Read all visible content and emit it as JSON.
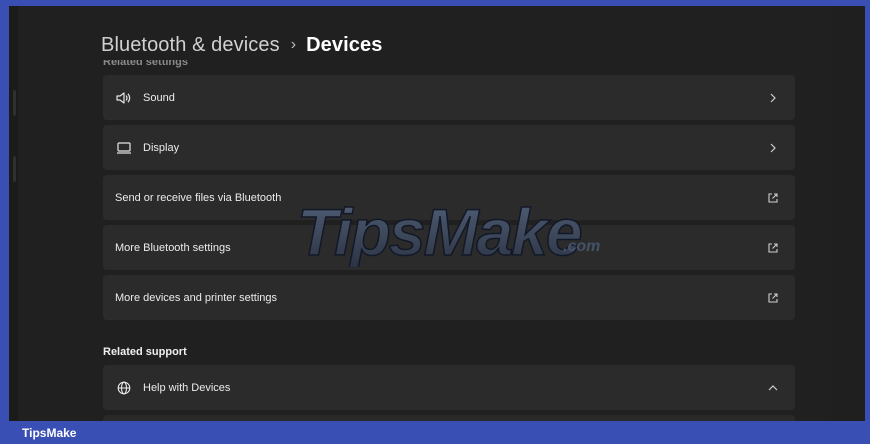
{
  "breadcrumb": {
    "parent": "Bluetooth & devices",
    "separator": "›",
    "current": "Devices"
  },
  "related_settings_header": "Related settings",
  "rows": [
    {
      "label": "Sound",
      "icon": "speaker-icon",
      "trailing": "chevron-right-icon"
    },
    {
      "label": "Display",
      "icon": "monitor-icon",
      "trailing": "chevron-right-icon"
    },
    {
      "label": "Send or receive files via Bluetooth",
      "icon": null,
      "trailing": "open-external-icon"
    },
    {
      "label": "More Bluetooth settings",
      "icon": null,
      "trailing": "open-external-icon"
    },
    {
      "label": "More devices and printer settings",
      "icon": null,
      "trailing": "open-external-icon"
    }
  ],
  "related_support": {
    "title": "Related support",
    "items": [
      {
        "label": "Help with Devices",
        "icon": "globe-icon",
        "trailing": "chevron-up-icon"
      }
    ]
  },
  "watermark": "TipsMake.com",
  "footer": {
    "text": "TipsMake"
  },
  "colors": {
    "frame": "#3a4fb3",
    "window_bg": "#202020",
    "card_bg": "#2b2b2b",
    "text": "#ffffff"
  }
}
